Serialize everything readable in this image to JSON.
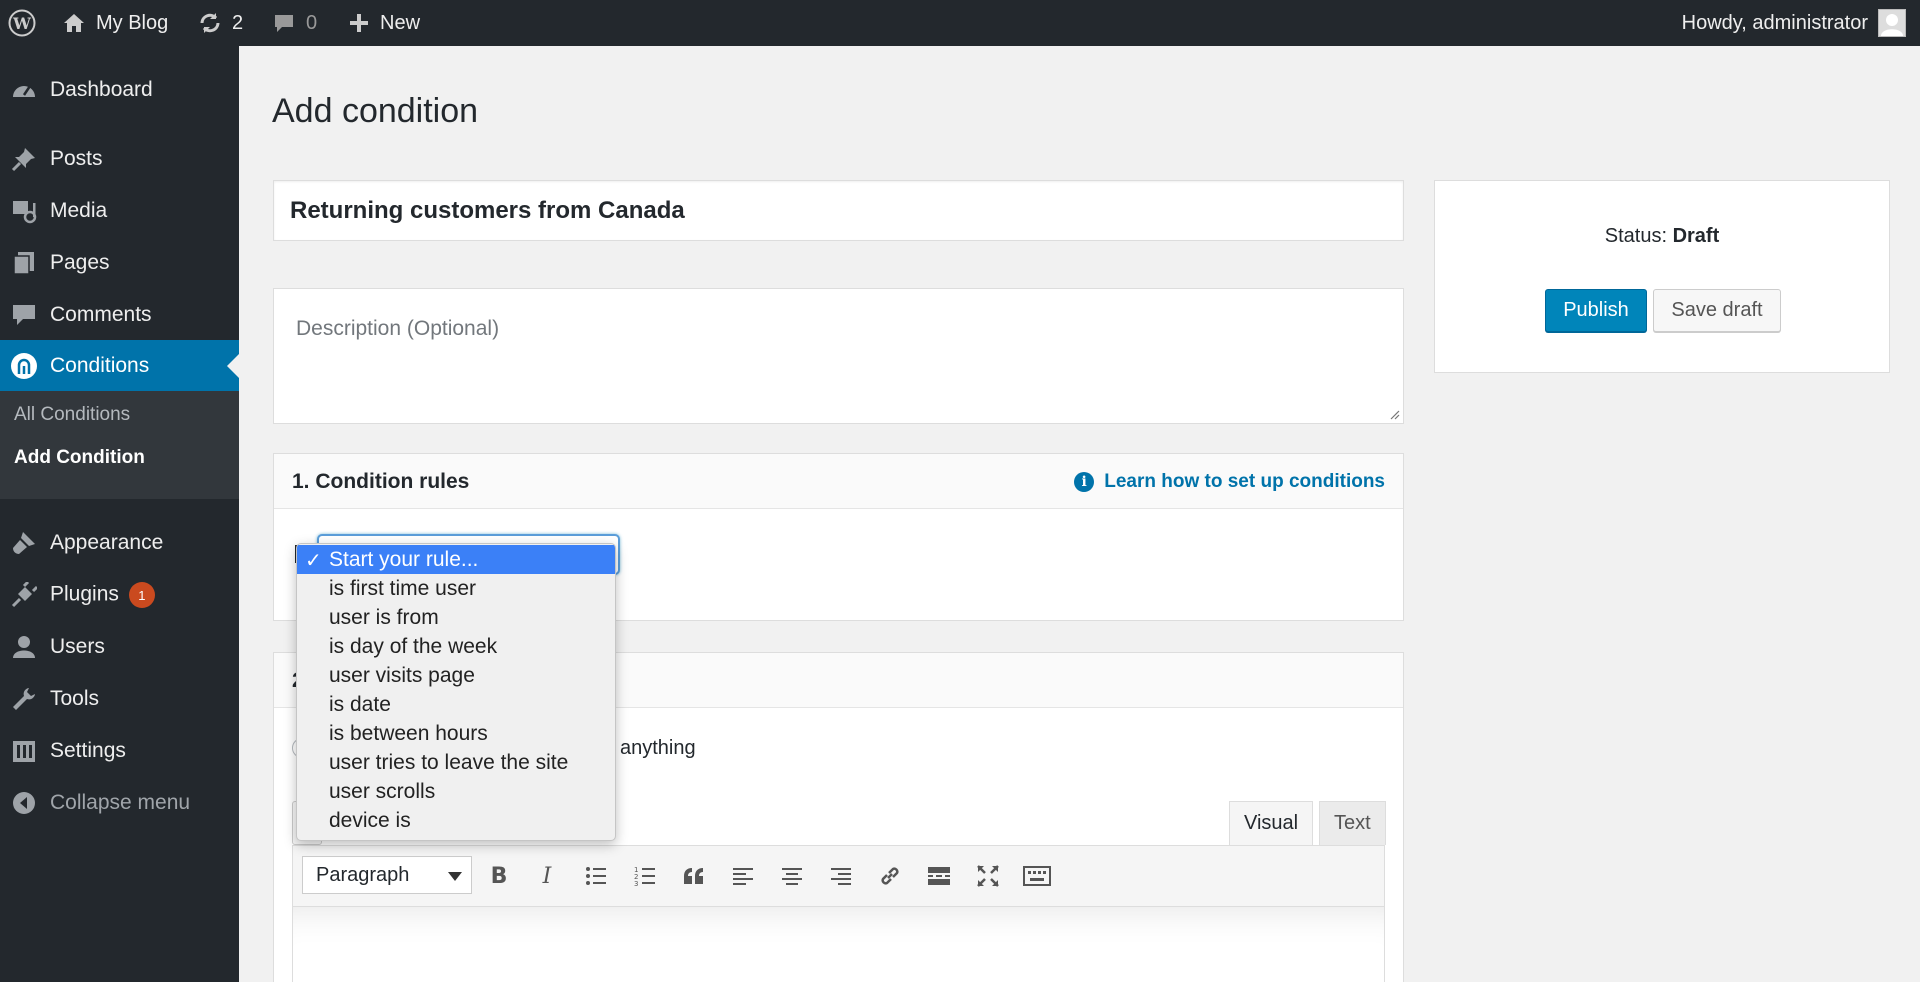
{
  "adminbar": {
    "site_name": "My Blog",
    "updates_count": "2",
    "comments_count": "0",
    "new_label": "New",
    "greeting": "Howdy, administrator"
  },
  "sidebar": {
    "items": [
      {
        "label": "Dashboard",
        "icon": "dashboard-icon"
      },
      {
        "label": "Posts",
        "icon": "pin-icon"
      },
      {
        "label": "Media",
        "icon": "media-icon"
      },
      {
        "label": "Pages",
        "icon": "pages-icon"
      },
      {
        "label": "Comments",
        "icon": "comment-icon"
      },
      {
        "label": "Conditions",
        "icon": "conditions-icon"
      },
      {
        "label": "Appearance",
        "icon": "brush-icon"
      },
      {
        "label": "Plugins",
        "icon": "plug-icon",
        "badge": "1"
      },
      {
        "label": "Users",
        "icon": "user-icon"
      },
      {
        "label": "Tools",
        "icon": "wrench-icon"
      },
      {
        "label": "Settings",
        "icon": "settings-icon"
      },
      {
        "label": "Collapse menu",
        "icon": "collapse-icon"
      }
    ],
    "submenu": [
      "All Conditions",
      "Add Condition"
    ]
  },
  "main": {
    "page_title": "Add condition",
    "title_value": "Returning customers from Canada",
    "description_placeholder": "Description (Optional)",
    "rules": {
      "heading": "1. Condition rules",
      "learn_link": "Learn how to set up conditions"
    },
    "section2": {
      "number": "2",
      "radio_text": "anything"
    },
    "editor": {
      "tab_visual": "Visual",
      "tab_text": "Text",
      "format_value": "Paragraph"
    }
  },
  "publish": {
    "status_label": "Status:",
    "status_value": "Draft",
    "publish_label": "Publish",
    "save_label": "Save draft"
  },
  "dropdown": {
    "options": [
      "Start your rule...",
      "is first time user",
      "user is from",
      "is day of the week",
      "user visits page",
      "is date",
      "is between hours",
      "user tries to leave the site",
      "user scrolls",
      "device is"
    ],
    "selected_index": 0
  },
  "colors": {
    "admin_dark": "#23282d",
    "accent_blue": "#0073aa",
    "publish_blue": "#0085ba",
    "badge_orange": "#ca4a1f",
    "select_highlight": "#3b80f7"
  }
}
